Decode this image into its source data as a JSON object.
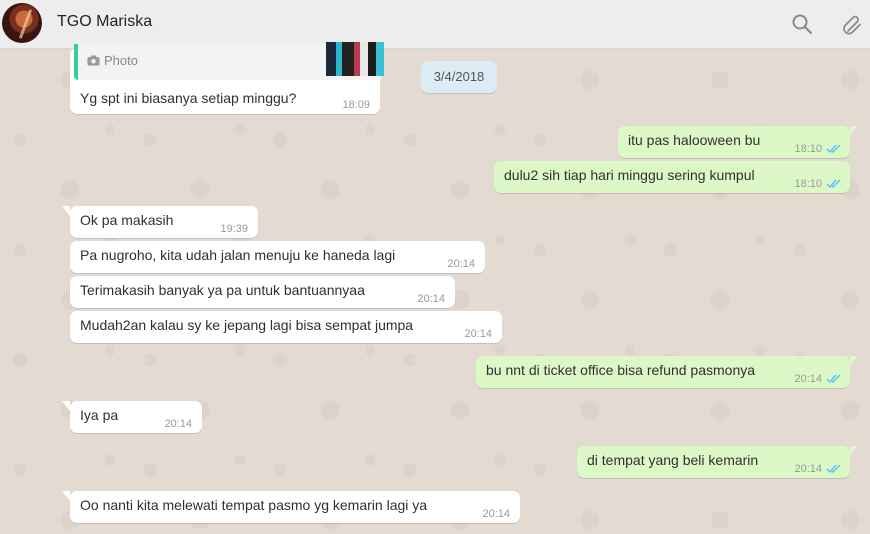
{
  "header": {
    "contact_name": "TGO Mariska",
    "avatar_icon": "avatar-photo",
    "search_icon": "search-icon",
    "attach_icon": "paperclip-icon"
  },
  "date_separator": "3/4/2018",
  "colors": {
    "outgoing_bubble": "#dcf8c6",
    "incoming_bubble": "#ffffff",
    "read_ticks": "#4fc3f7",
    "quote_bar": "#35cd96",
    "date_chip": "#dcecf4"
  },
  "messages": [
    {
      "dir": "in",
      "text": "Yg spt ini biasanya setiap minggu?",
      "time": "18:09",
      "quote_label": "Photo"
    },
    {
      "dir": "out",
      "text": "itu pas halooween bu",
      "time": "18:10"
    },
    {
      "dir": "out",
      "text": "dulu2 sih tiap hari minggu sering kumpul",
      "time": "18:10"
    },
    {
      "dir": "in",
      "text": "Ok pa makasih",
      "time": "19:39"
    },
    {
      "dir": "in",
      "text": "Pa nugroho, kita udah jalan menuju ke haneda lagi",
      "time": "20:14"
    },
    {
      "dir": "in",
      "text": "Terimakasih banyak ya pa untuk bantuannyaa",
      "time": "20:14"
    },
    {
      "dir": "in",
      "text": "Mudah2an kalau sy ke jepang lagi bisa sempat jumpa",
      "time": "20:14"
    },
    {
      "dir": "out",
      "text": "bu nnt di ticket office bisa refund pasmonya",
      "time": "20:14"
    },
    {
      "dir": "in",
      "text": "Iya pa",
      "time": "20:14"
    },
    {
      "dir": "out",
      "text": "di tempat yang beli kemarin",
      "time": "20:14"
    },
    {
      "dir": "in",
      "text": "Oo nanti kita melewati tempat pasmo yg kemarin lagi ya",
      "time": "20:14"
    }
  ]
}
